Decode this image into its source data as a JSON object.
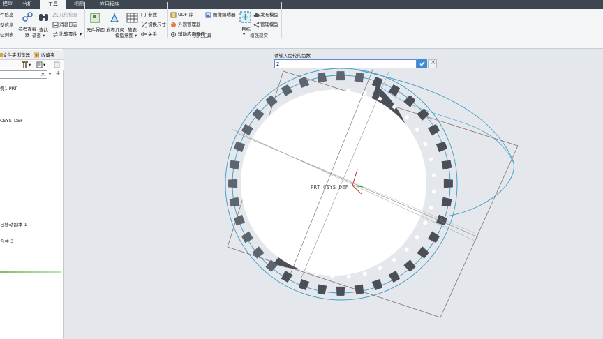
{
  "tabs": [
    {
      "label": "模型",
      "active": false
    },
    {
      "label": "分析",
      "active": false
    },
    {
      "label": "工具",
      "active": true
    },
    {
      "label": "视图",
      "active": false
    },
    {
      "label": "应用程序",
      "active": false
    }
  ],
  "ribbon": {
    "investigate": {
      "title": "调查",
      "items": [
        "件信息",
        "型信息",
        "征列表"
      ],
      "reference_viewer": "参考查看器",
      "find": "查找",
      "geometry_check": "几何检查",
      "message_log": "消息日志",
      "compare_part": "比较零件"
    },
    "model_intent": {
      "title": "模型意图",
      "component_interface": "元件界面",
      "publish_geometry": "发布几何",
      "table": "族表",
      "parameters": "参数",
      "switch_dimensions": "切换尺寸",
      "relations": "关系"
    },
    "utilities": {
      "title": "实用工具",
      "udf_library": "UDF 库",
      "appearance_manager": "外观管理器",
      "auxiliary_apps": "辅助应用程序",
      "image_editor": "图像编辑器"
    },
    "augmented_reality": {
      "title": "增强现实",
      "target": "目标",
      "publish_model": "发布模型",
      "manage_model": "管理模型"
    }
  },
  "left_panel": {
    "tabs": [
      "文件夹浏览器",
      "收藏夹"
    ],
    "tree": [
      "例1.PRT",
      "CSYS_DEF",
      "已移动副本 1",
      "合并 3"
    ]
  },
  "dialog": {
    "prompt": "请输入齿轮的齿数",
    "value": "2"
  },
  "viewport": {
    "csys_label": "PRT_CSYS_DEF",
    "gear_teeth_visible": 36,
    "gear_color": "#4a4f58",
    "curve_color": "#3e9cc7",
    "outline_color": "#8a6e6e"
  }
}
